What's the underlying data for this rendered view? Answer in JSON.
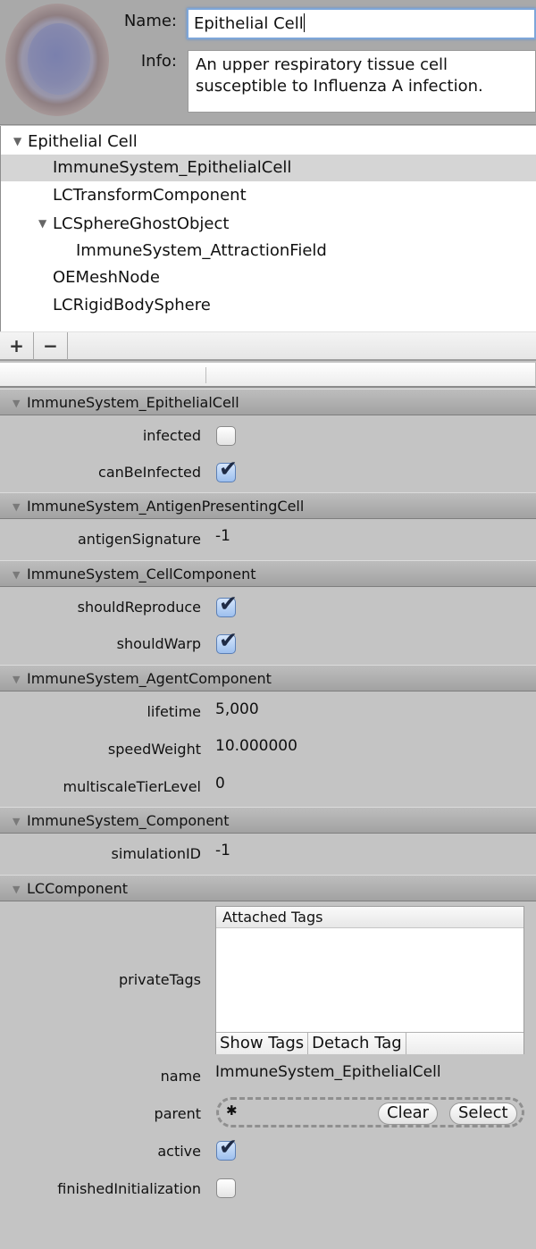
{
  "header": {
    "name_label": "Name:",
    "name_value": "Epithelial Cell",
    "info_label": "Info:",
    "info_value": "An upper respiratory tissue cell susceptible to Influenza A infection.",
    "icon": "cell-image"
  },
  "tree": {
    "items": [
      {
        "label": "Epithelial Cell",
        "expanded": true,
        "depth": 0,
        "selected": false
      },
      {
        "label": "ImmuneSystem_EpithelialCell",
        "depth": 1,
        "selected": true
      },
      {
        "label": "LCTransformComponent",
        "depth": 1,
        "selected": false
      },
      {
        "label": "LCSphereGhostObject",
        "expanded": true,
        "depth": 1,
        "selected": false
      },
      {
        "label": "ImmuneSystem_AttractionField",
        "depth": 2,
        "selected": false
      },
      {
        "label": "OEMeshNode",
        "depth": 1,
        "selected": false
      },
      {
        "label": "LCRigidBodySphere",
        "depth": 1,
        "selected": false
      }
    ],
    "add_label": "+",
    "remove_label": "−",
    "expand_glyph": "▼"
  },
  "sections": [
    {
      "title": "ImmuneSystem_EpithelialCell",
      "props": [
        {
          "label": "infected",
          "type": "checkbox",
          "checked": false
        },
        {
          "label": "canBeInfected",
          "type": "checkbox",
          "checked": true
        }
      ]
    },
    {
      "title": "ImmuneSystem_AntigenPresentingCell",
      "props": [
        {
          "label": "antigenSignature",
          "type": "text",
          "value": "-1"
        }
      ]
    },
    {
      "title": "ImmuneSystem_CellComponent",
      "props": [
        {
          "label": "shouldReproduce",
          "type": "checkbox",
          "checked": true
        },
        {
          "label": "shouldWarp",
          "type": "checkbox",
          "checked": true
        }
      ]
    },
    {
      "title": "ImmuneSystem_AgentComponent",
      "props": [
        {
          "label": "lifetime",
          "type": "text",
          "value": "5,000"
        },
        {
          "label": "speedWeight",
          "type": "text",
          "value": "10.000000"
        },
        {
          "label": "multiscaleTierLevel",
          "type": "text",
          "value": "0"
        }
      ]
    },
    {
      "title": "ImmuneSystem_Component",
      "props": [
        {
          "label": "simulationID",
          "type": "text",
          "value": "-1"
        }
      ]
    },
    {
      "title": "LCComponent",
      "props": [
        {
          "label": "privateTags",
          "type": "tags"
        },
        {
          "label": "name",
          "type": "text",
          "value": "ImmuneSystem_EpithelialCell"
        },
        {
          "label": "parent",
          "type": "object-slot"
        },
        {
          "label": "active",
          "type": "checkbox",
          "checked": true
        },
        {
          "label": "finishedInitialization",
          "type": "checkbox",
          "checked": false
        }
      ]
    }
  ],
  "tags": {
    "column_header": "Attached Tags",
    "items": [],
    "show_tags_label": "Show Tags",
    "detach_tag_label": "Detach Tag"
  },
  "parent_slot": {
    "icon": "gear-icon",
    "clear_label": "Clear",
    "select_label": "Select"
  },
  "check_glyph": "✔"
}
